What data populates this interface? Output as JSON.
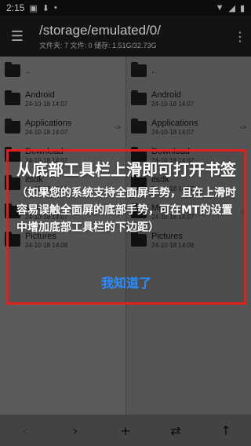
{
  "status_bar": {
    "time": "2:15",
    "left_icons": [
      "message-icon",
      "download-icon",
      "notification-dot-icon"
    ],
    "right_icons": [
      "wifi-icon",
      "signal-icon",
      "battery-icon"
    ]
  },
  "app_bar": {
    "path": "/storage/emulated/0/",
    "subtitle": "文件夹: 7  文件: 0  储存: 1.51G/32.73G"
  },
  "left_panel": {
    "items": [
      {
        "name": "..",
        "date": ""
      },
      {
        "name": "Android",
        "date": "24-10-18 14:07"
      },
      {
        "name": "Applications",
        "date": "24-10-18 14:07",
        "arrow": "->"
      },
      {
        "name": "Download",
        "date": "24-10-18 14:07"
      },
      {
        "name": "itsdk",
        "date": "24-10-18 14:07"
      },
      {
        "name": "Misc",
        "date": "24-10-18 14:07",
        "arrow": "->"
      },
      {
        "name": "Pictures",
        "date": "24-10-18 14:08"
      }
    ]
  },
  "right_panel": {
    "items": [
      {
        "name": "..",
        "date": ""
      },
      {
        "name": "Android",
        "date": "24-10-18 14:07"
      },
      {
        "name": "Applications",
        "date": "24-10-18 14:07",
        "arrow": "->"
      },
      {
        "name": "Download",
        "date": "24-10-18 14:07"
      },
      {
        "name": "itsdk",
        "date": "24-10-18 14:07"
      },
      {
        "name": "Misc",
        "date": "24-10-18 14:07",
        "arrow": "->"
      },
      {
        "name": "Pictures",
        "date": "24-10-18 14:08"
      }
    ]
  },
  "tip": {
    "title": "从底部工具栏上滑即可打开书签",
    "description": "（如果您的系统支持全面屏手势，且在上滑时容易误触全面屏的底部手势，可在MT的设置中增加底部工具栏的下边距）",
    "action_label": "我知道了"
  },
  "bottom_bar": {
    "buttons": [
      "back-arrow-icon",
      "forward-arrow-icon",
      "add-icon",
      "swap-icon",
      "up-arrow-icon"
    ]
  },
  "colors": {
    "tip_border": "#e02020",
    "tip_action": "#2a8cff"
  }
}
